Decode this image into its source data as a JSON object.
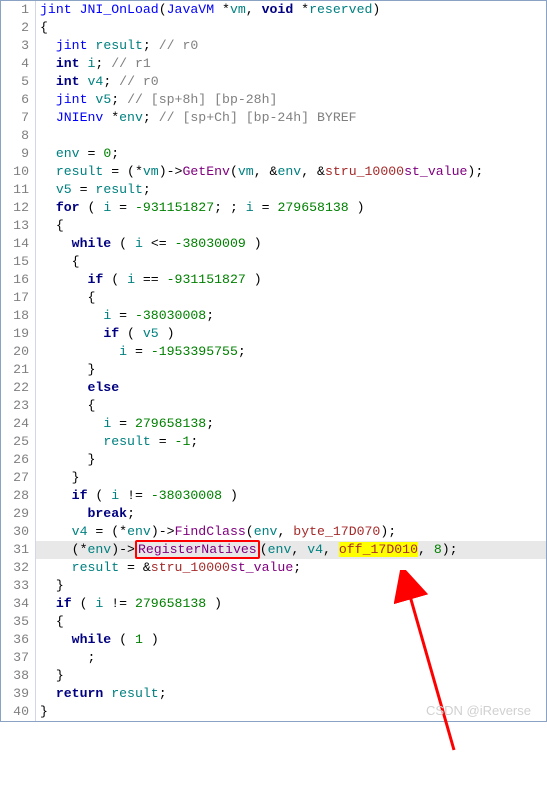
{
  "lines": {
    "l1": {
      "fn": "jint",
      "sp": " ",
      "name": "JNI_OnLoad",
      "open": "(",
      "p1t": "JavaVM",
      "p1s": " *",
      "p1n": "vm",
      "c1": ", ",
      "p2t": "void",
      "p2s": " *",
      "p2n": "reserved",
      "close": ")"
    },
    "l2": {
      "t": "{"
    },
    "l3": {
      "indent": "  ",
      "t1": "jint",
      "sp": " ",
      "v": "result",
      "semi": "; ",
      "cm": "// r0"
    },
    "l4": {
      "indent": "  ",
      "t1": "int",
      "sp": " ",
      "v": "i",
      "semi": "; ",
      "cm": "// r1"
    },
    "l5": {
      "indent": "  ",
      "t1": "int",
      "sp": " ",
      "v": "v4",
      "semi": "; ",
      "cm": "// r0"
    },
    "l6": {
      "indent": "  ",
      "t1": "jint",
      "sp": " ",
      "v": "v5",
      "semi": "; ",
      "cm": "// [sp+8h] [bp-28h]"
    },
    "l7": {
      "indent": "  ",
      "t1": "JNIEnv",
      "sp": " *",
      "v": "env",
      "semi": "; ",
      "cm": "// [sp+Ch] [bp-24h] BYREF"
    },
    "l9": {
      "indent": "  ",
      "v": "env",
      "eq": " = ",
      "n": "0",
      "semi": ";"
    },
    "l10": {
      "indent": "  ",
      "v": "result",
      "eq": " = (*",
      "a": "vm",
      "mid": ")->",
      "fn": "GetEnv",
      "open": "(",
      "a1": "vm",
      "c1": ", &",
      "a2": "env",
      "c2": ", &",
      "a3": "stru_10000",
      ".": ".",
      "fld": "st_value",
      "close": ");"
    },
    "l11": {
      "indent": "  ",
      "v": "v5",
      "eq": " = ",
      "a": "result",
      "semi": ";"
    },
    "l12": {
      "indent": "  ",
      "kw": "for",
      "open": " ( ",
      "v": "i",
      "eq": " = ",
      "n1": "-931151827",
      "sep": "; ; ",
      "v2": "i",
      "eq2": " = ",
      "n2": "279658138",
      "close": " )"
    },
    "l13": {
      "indent": "  ",
      "t": "{"
    },
    "l14": {
      "indent": "    ",
      "kw": "while",
      "open": " ( ",
      "v": "i",
      "op": " <= ",
      "n": "-38030009",
      "close": " )"
    },
    "l15": {
      "indent": "    ",
      "t": "{"
    },
    "l16": {
      "indent": "      ",
      "kw": "if",
      "open": " ( ",
      "v": "i",
      "op": " == ",
      "n": "-931151827",
      "close": " )"
    },
    "l17": {
      "indent": "      ",
      "t": "{"
    },
    "l18": {
      "indent": "        ",
      "v": "i",
      "eq": " = ",
      "n": "-38030008",
      "semi": ";"
    },
    "l19": {
      "indent": "        ",
      "kw": "if",
      "open": " ( ",
      "v": "v5",
      "close": " )"
    },
    "l20": {
      "indent": "          ",
      "v": "i",
      "eq": " = ",
      "n": "-1953395755",
      "semi": ";"
    },
    "l21": {
      "indent": "      ",
      "t": "}"
    },
    "l22": {
      "indent": "      ",
      "kw": "else"
    },
    "l23": {
      "indent": "      ",
      "t": "{"
    },
    "l24": {
      "indent": "        ",
      "v": "i",
      "eq": " = ",
      "n": "279658138",
      "semi": ";"
    },
    "l25": {
      "indent": "        ",
      "v": "result",
      "eq": " = ",
      "n": "-1",
      "semi": ";"
    },
    "l26": {
      "indent": "      ",
      "t": "}"
    },
    "l27": {
      "indent": "    ",
      "t": "}"
    },
    "l28": {
      "indent": "    ",
      "kw": "if",
      "open": " ( ",
      "v": "i",
      "op": " != ",
      "n": "-38030008",
      "close": " )"
    },
    "l29": {
      "indent": "      ",
      "kw": "break",
      "semi": ";"
    },
    "l30": {
      "indent": "    ",
      "v": "v4",
      "eq": " = (*",
      "a": "env",
      "mid": ")->",
      "fn": "FindClass",
      "open": "(",
      "a1": "env",
      "c1": ", ",
      "a2": "byte_17D070",
      "close": ");"
    },
    "l31": {
      "indent": "    (*",
      "a": "env",
      "mid": ")->",
      "fn": "RegisterNatives",
      "open": "(",
      "a1": "env",
      "c1": ", ",
      "a2": "v4",
      "c2": ", ",
      "a3": "off_17D010",
      "c3": ", ",
      "n": "8",
      "close": ");"
    },
    "l32": {
      "indent": "    ",
      "v": "result",
      "eq": " = &",
      "a": "stru_10000",
      ".": ".",
      "fld": "st_value",
      "semi": ";"
    },
    "l33": {
      "indent": "  ",
      "t": "}"
    },
    "l34": {
      "indent": "  ",
      "kw": "if",
      "open": " ( ",
      "v": "i",
      "op": " != ",
      "n": "279658138",
      "close": " )"
    },
    "l35": {
      "indent": "  ",
      "t": "{"
    },
    "l36": {
      "indent": "    ",
      "kw": "while",
      "open": " ( ",
      "n": "1",
      "close": " )"
    },
    "l37": {
      "indent": "      ",
      "semi": ";"
    },
    "l38": {
      "indent": "  ",
      "t": "}"
    },
    "l39": {
      "indent": "  ",
      "kw": "return",
      "sp": " ",
      "v": "result",
      "semi": ";"
    },
    "l40": {
      "t": "}"
    }
  },
  "ln": {
    "1": "1",
    "2": "2",
    "3": "3",
    "4": "4",
    "5": "5",
    "6": "6",
    "7": "7",
    "8": "8",
    "9": "9",
    "10": "10",
    "11": "11",
    "12": "12",
    "13": "13",
    "14": "14",
    "15": "15",
    "16": "16",
    "17": "17",
    "18": "18",
    "19": "19",
    "20": "20",
    "21": "21",
    "22": "22",
    "23": "23",
    "24": "24",
    "25": "25",
    "26": "26",
    "27": "27",
    "28": "28",
    "29": "29",
    "30": "30",
    "31": "31",
    "32": "32",
    "33": "33",
    "34": "34",
    "35": "35",
    "36": "36",
    "37": "37",
    "38": "38",
    "39": "39",
    "40": "40"
  },
  "watermark": "CSDN @iReverse"
}
